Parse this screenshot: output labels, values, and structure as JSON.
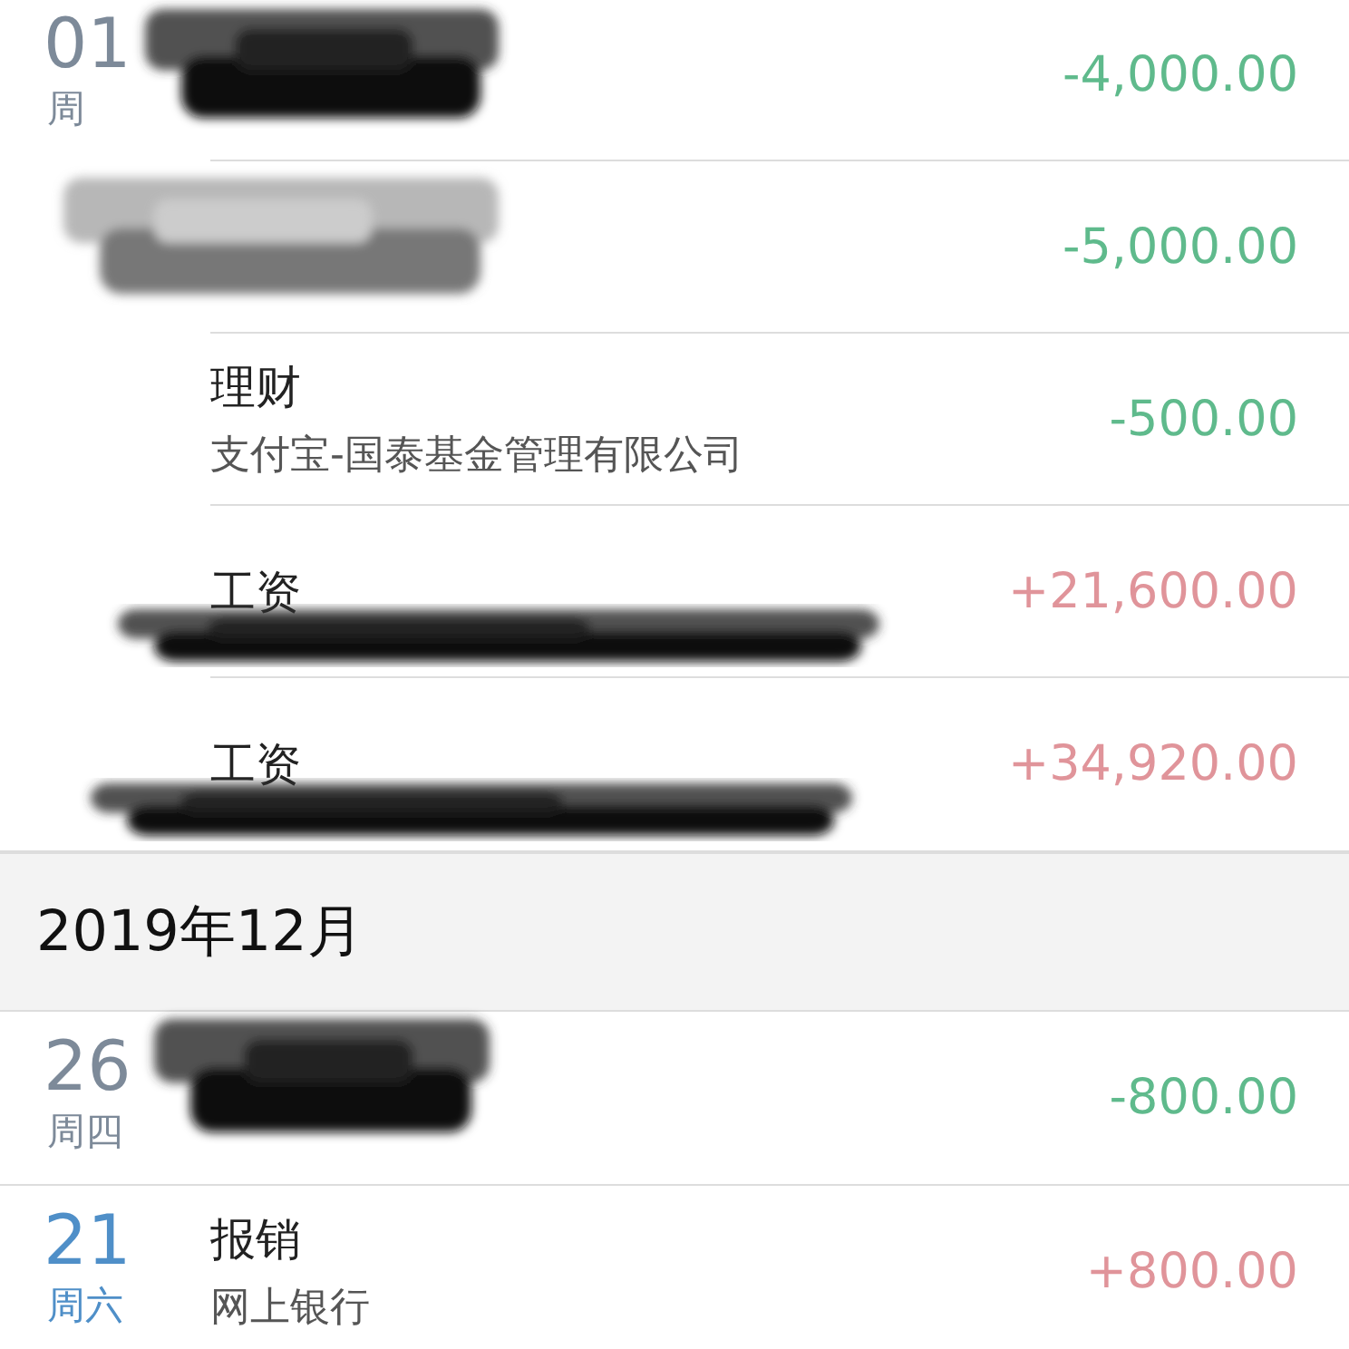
{
  "sections": [
    {
      "days": [
        {
          "day": "01",
          "weekday": "周",
          "weekend": false,
          "entries": [
            {
              "amount": "-4,000.00",
              "kind": "expense"
            },
            {
              "amount": "-5,000.00",
              "kind": "expense"
            },
            {
              "title": "理财",
              "subtitle": "支付宝-国泰基金管理有限公司",
              "amount": "-500.00",
              "kind": "expense"
            },
            {
              "title": "工资",
              "amount": "+21,600.00",
              "kind": "income"
            },
            {
              "title": "工资",
              "amount": "+34,920.00",
              "kind": "income"
            }
          ]
        }
      ]
    },
    {
      "header": "2019年12月",
      "days": [
        {
          "day": "26",
          "weekday": "周四",
          "weekend": false,
          "entries": [
            {
              "amount": "-800.00",
              "kind": "expense"
            }
          ]
        },
        {
          "day": "21",
          "weekday": "周六",
          "weekend": true,
          "entries": [
            {
              "title": "报销",
              "subtitle": "网上银行",
              "amount": "+800.00",
              "kind": "income"
            }
          ]
        }
      ]
    }
  ]
}
